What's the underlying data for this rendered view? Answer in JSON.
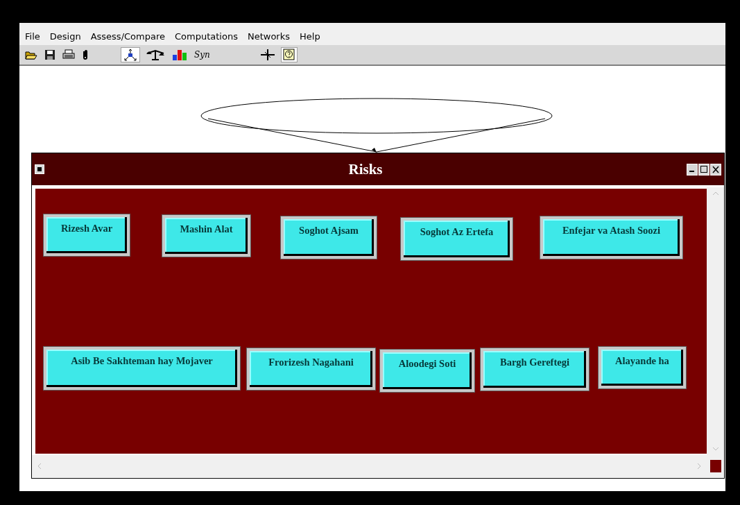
{
  "menu": [
    "File",
    "Design",
    "Assess/Compare",
    "Computations",
    "Networks",
    "Help"
  ],
  "toolbar": [
    {
      "kind": "open",
      "pressed": false
    },
    {
      "kind": "save",
      "pressed": false
    },
    {
      "kind": "print",
      "pressed": false
    },
    {
      "kind": "clip",
      "pressed": false
    },
    {
      "kind": "gap"
    },
    {
      "kind": "model",
      "pressed": true
    },
    {
      "kind": "balance",
      "pressed": false
    },
    {
      "kind": "bars",
      "pressed": false
    },
    {
      "kind": "text",
      "label": "Syn",
      "pressed": false
    },
    {
      "kind": "gap"
    },
    {
      "kind": "cross",
      "pressed": false
    },
    {
      "kind": "help",
      "pressed": true
    }
  ],
  "window": {
    "title": "Risks",
    "nodes": [
      {
        "label": "Rizesh Avar"
      },
      {
        "label": "Mashin Alat"
      },
      {
        "label": "Soghot Ajsam"
      },
      {
        "label": "Soghot Az Ertefa"
      },
      {
        "label": "Enfejar va Atash Soozi"
      },
      {
        "label": "Asib Be Sakhteman hay Mojaver"
      },
      {
        "label": "Frorizesh Nagahani"
      },
      {
        "label": "Aloodegi Soti"
      },
      {
        "label": "Bargh Gereftegi"
      },
      {
        "label": "Alayande ha"
      }
    ]
  }
}
